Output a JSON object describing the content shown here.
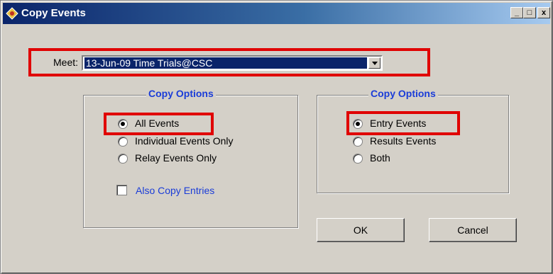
{
  "window": {
    "title": "Copy Events",
    "title_icon": "app-icon",
    "minimize": "_",
    "maximize": "□",
    "close": "x"
  },
  "meet": {
    "label": "Meet:",
    "selected": "13-Jun-09 Time Trials@CSC"
  },
  "left_group": {
    "title": "Copy Options",
    "options": [
      {
        "label": "All Events",
        "checked": true
      },
      {
        "label": "Individual Events Only",
        "checked": false
      },
      {
        "label": "Relay Events Only",
        "checked": false
      }
    ],
    "checkbox_label": "Also Copy Entries",
    "checkbox_checked": false
  },
  "right_group": {
    "title": "Copy Options",
    "options": [
      {
        "label": "Entry Events",
        "checked": true
      },
      {
        "label": "Results Events",
        "checked": false
      },
      {
        "label": "Both",
        "checked": false
      }
    ]
  },
  "buttons": {
    "ok": "OK",
    "cancel": "Cancel"
  },
  "colors": {
    "highlight": "#e00000",
    "group_title": "#1a3cd8",
    "title_bar": "#0a246a"
  }
}
